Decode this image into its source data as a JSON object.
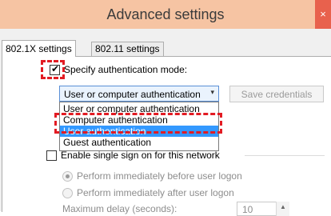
{
  "window": {
    "title": "Advanced settings",
    "close_glyph": "×"
  },
  "tabs": [
    {
      "label": "802.1X settings",
      "active": true
    },
    {
      "label": "802.11 settings",
      "active": false
    }
  ],
  "auth": {
    "checkbox_label": "Specify authentication mode:",
    "checked": true,
    "select_value": "User or computer authentication",
    "options": [
      "User or computer authentication",
      "Computer authentication",
      "User authentication",
      "Guest authentication"
    ],
    "selected_option": "User authentication",
    "save_button": "Save credentials"
  },
  "sso": {
    "checkbox_label": "Enable single sign on for this network",
    "checked": false,
    "radio_before": "Perform immediately before user logon",
    "radio_after": "Perform immediately after user logon",
    "delay_label": "Maximum delay (seconds):",
    "delay_value": "10"
  },
  "colors": {
    "titlebar": "#f6c4a3",
    "close": "#e8614d",
    "highlight": "#e21b23",
    "selection": "#3399ff"
  }
}
